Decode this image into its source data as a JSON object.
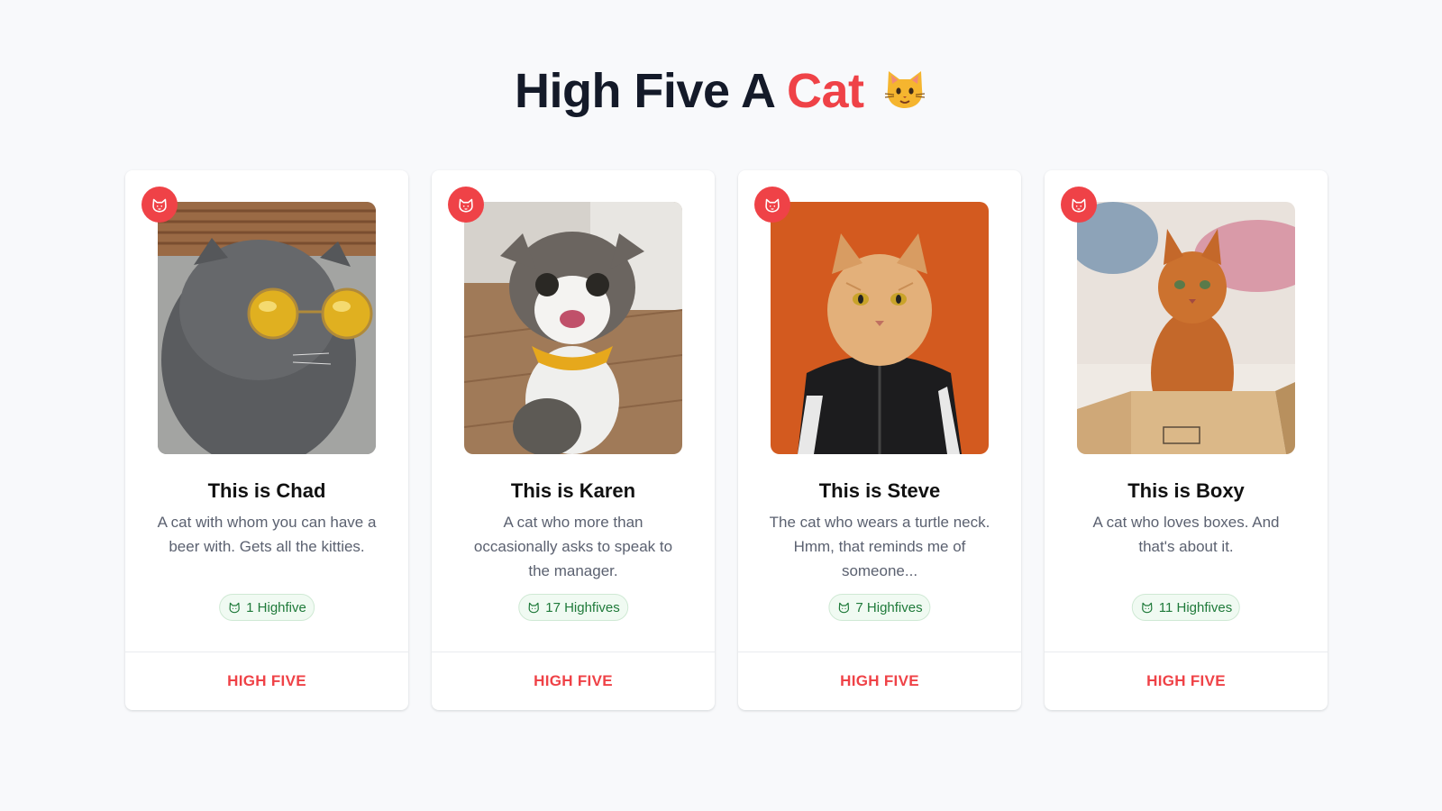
{
  "header": {
    "title_prefix": "High Five A",
    "title_accent": "Cat",
    "title_emoji": "cat-face-emoji"
  },
  "colors": {
    "accent": "#ef4247",
    "success_text": "#1f7a3a",
    "success_bg": "#f0faf2",
    "background": "#f8f9fb"
  },
  "cards": [
    {
      "name": "This is Chad",
      "description": "A cat with whom you can have a beer with. Gets all the kitties.",
      "highfives": "1 Highfive",
      "action": "HIGH FIVE",
      "photo": "grey-cat-with-sunglasses"
    },
    {
      "name": "This is Karen",
      "description": "A cat who more than occasionally asks to speak to the manager.",
      "highfives": "17 Highfives",
      "action": "HIGH FIVE",
      "photo": "tabby-cat-with-yellow-bandana"
    },
    {
      "name": "This is Steve",
      "description": "The cat who wears a turtle neck. Hmm, that reminds me of someone...",
      "highfives": "7 Highfives",
      "action": "HIGH FIVE",
      "photo": "orange-cat-in-track-jacket"
    },
    {
      "name": "This is Boxy",
      "description": "A cat who loves boxes. And that's about it.",
      "highfives": "11 Highfives",
      "action": "HIGH FIVE",
      "photo": "ginger-cat-in-cardboard-box"
    }
  ]
}
